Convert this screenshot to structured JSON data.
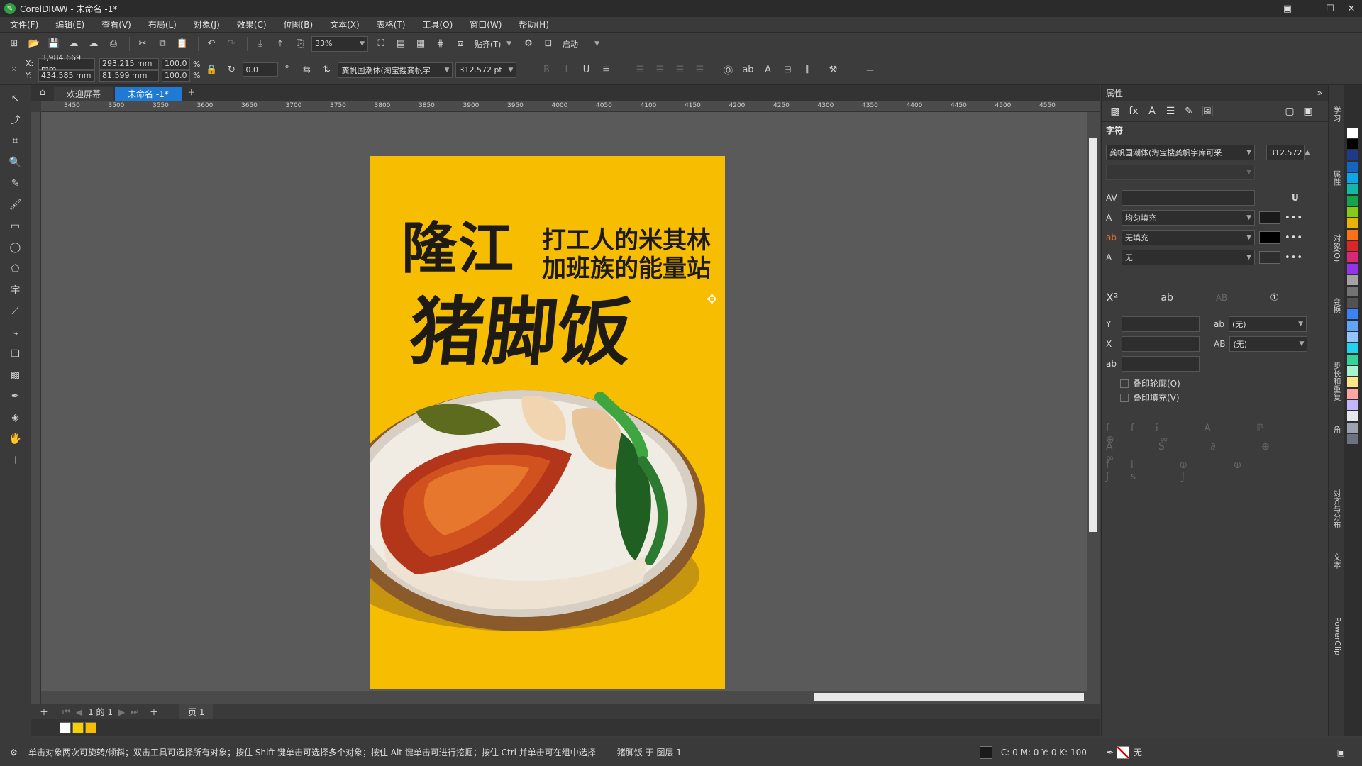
{
  "window": {
    "title": "CorelDRAW - 未命名 -1*"
  },
  "menu": [
    "文件(F)",
    "编辑(E)",
    "查看(V)",
    "布局(L)",
    "对象(J)",
    "效果(C)",
    "位图(B)",
    "文本(X)",
    "表格(T)",
    "工具(O)",
    "窗口(W)",
    "帮助(H)"
  ],
  "toolbar1": {
    "zoom": "33%",
    "snap_label": "贴齐(T)",
    "launch_label": "启动"
  },
  "toolbar2": {
    "x": "3,984.669 mm",
    "y": "434.585 mm",
    "w": "293.215 mm",
    "h": "81.599 mm",
    "scale_w": "100.0",
    "scale_h": "100.0",
    "pct": "%",
    "angle": "0.0",
    "font": "龚帆国潮体(淘宝搜龚帆字",
    "font_size": "312.572 pt",
    "x_label": "X:",
    "y_label": "Y:"
  },
  "tabs": {
    "welcome": "欢迎屏幕",
    "document": "未命名 -1*"
  },
  "ruler_ticks": [
    "3450",
    "3500",
    "3550",
    "3600",
    "3650",
    "3700",
    "3750",
    "3800",
    "3850",
    "3900",
    "3950",
    "4000",
    "4050",
    "4100",
    "4150",
    "4200",
    "4250",
    "4300",
    "4350",
    "4400",
    "4450",
    "4500",
    "4550"
  ],
  "poster": {
    "brand": "隆江",
    "slogan1": "打工人的米其林",
    "slogan2": "加班族的能量站",
    "dish": "猪脚饭",
    "bg_color": "#f7bd00"
  },
  "pagebar": {
    "page_count": "1 的 1",
    "page_tab": "页 1"
  },
  "status": {
    "hint": "单击对象两次可旋转/倾斜；双击工具可选择所有对象；按住 Shift 键单击可选择多个对象；按住 Alt 键单击可进行挖掘；按住 Ctrl 并单击可在组中选择",
    "object": "猪脚饭 于 图层 1",
    "color": "C: 0 M: 0 Y: 0 K: 100",
    "outline": "无"
  },
  "props": {
    "panel_title": "属性",
    "section": "字符",
    "font": "龚帆国潮体(淘宝搜龚帆字库可采",
    "size": "312.572",
    "fill1": "均匀填充",
    "fill2": "无填充",
    "fill3": "无",
    "none1": "(无)",
    "none2": "(无)",
    "overprint_outline": "叠印轮廓(O)",
    "overprint_fill": "叠印填充(V)"
  },
  "dockers": [
    "学习",
    "属性",
    "对象(O)",
    "变换",
    "步长和重复",
    "角",
    "对齐与分布",
    "文本",
    "PowerClip"
  ],
  "palette": [
    "#ffffff",
    "#000000",
    "#1e3a8a",
    "#1565c0",
    "#0ea5e9",
    "#14b8a6",
    "#16a34a",
    "#84cc16",
    "#eab308",
    "#f97316",
    "#dc2626",
    "#db2777",
    "#9333ea",
    "#a3a3a3",
    "#737373",
    "#525252",
    "#3b82f6",
    "#60a5fa",
    "#93c5fd",
    "#22d3ee",
    "#34d399",
    "#a7f3d0",
    "#fde68a",
    "#fca5a5",
    "#c4b5fd",
    "#e5e7eb",
    "#9ca3af",
    "#6b7280"
  ],
  "swatches": [
    "#ffffff",
    "#f7d000",
    "#f7bd00"
  ]
}
